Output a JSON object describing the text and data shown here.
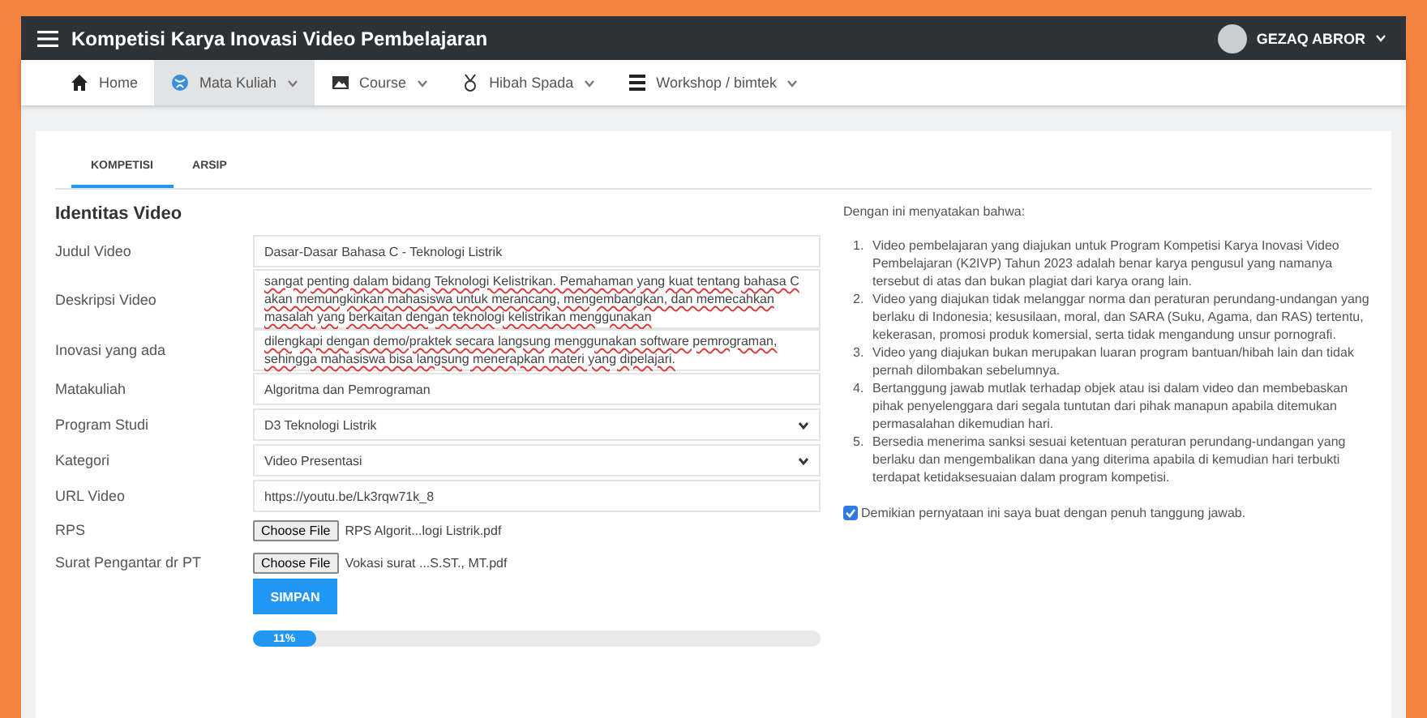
{
  "header": {
    "title": "Kompetisi Karya Inovasi Video Pembelajaran",
    "user": "GEZAQ ABROR"
  },
  "nav": [
    {
      "kind": "link",
      "label": "Home",
      "selected": false
    },
    {
      "kind": "menu",
      "label": "Mata Kuliah",
      "selected": true
    },
    {
      "kind": "menu",
      "label": "Course",
      "selected": false
    },
    {
      "kind": "menu",
      "label": "Hibah Spada",
      "selected": false
    },
    {
      "kind": "menu",
      "label": "Workshop / bimtek",
      "selected": false
    }
  ],
  "tabs": [
    {
      "label": "KOMPETISI",
      "selected": true
    },
    {
      "label": "ARSIP",
      "selected": false
    }
  ],
  "form": {
    "title": "Identitas Video",
    "fields": [
      {
        "kind": "text",
        "label": "Judul Video",
        "value": "Dasar-Dasar Bahasa C - Teknologi Listrik"
      },
      {
        "kind": "textarea",
        "label": "Deskripsi Video",
        "value": "sangat penting dalam bidang Teknologi Kelistrikan. Pemahaman yang kuat tentang bahasa C akan memungkinkan mahasiswa untuk merancang, mengembangkan, dan memecahkan masalah yang berkaitan dengan teknologi kelistrikan menggunakan"
      },
      {
        "kind": "textarea",
        "label": "Inovasi yang ada",
        "value": "dilengkapi dengan demo/praktek secara langsung menggunakan software pemrograman, sehingga mahasiswa bisa langsung menerapkan materi yang dipelajari."
      },
      {
        "kind": "text",
        "label": "Matakuliah",
        "value": "Algoritma dan Pemrograman"
      },
      {
        "kind": "select",
        "label": "Program Studi",
        "value": "D3 Teknologi Listrik"
      },
      {
        "kind": "select",
        "label": "Kategori",
        "value": "Video Presentasi"
      },
      {
        "kind": "text",
        "label": "URL Video",
        "value": "https://youtu.be/Lk3rqw71k_8"
      },
      {
        "kind": "file",
        "label": "RPS",
        "button": "Choose File",
        "value": "RPS Algorit...logi Listrik.pdf"
      },
      {
        "kind": "file",
        "label": "Surat Pengantar dr PT",
        "button": "Choose File",
        "value": "Vokasi surat ...S.ST., MT.pdf"
      }
    ],
    "submit": "SIMPAN",
    "progress": {
      "level": 0.11,
      "label": "11%"
    }
  },
  "statement": {
    "intro": "Dengan ini menyatakan bahwa:",
    "items": [
      {
        "number": "1.",
        "text": "Video pembelajaran yang diajukan untuk Program Kompetisi Karya Inovasi Video Pembelajaran (K2IVP) Tahun 2023 adalah benar karya pengusul yang namanya tersebut di atas dan bukan plagiat dari karya orang lain."
      },
      {
        "number": "2.",
        "text": "Video yang diajukan tidak melanggar norma dan peraturan perundang-undangan yang berlaku di Indonesia; kesusilaan, moral, dan SARA (Suku, Agama, dan RAS) tertentu, kekerasan, promosi produk komersial, serta tidak mengandung unsur pornografi."
      },
      {
        "number": "3.",
        "text": "Video yang diajukan bukan merupakan luaran program bantuan/hibah lain dan tidak pernah dilombakan sebelumnya."
      },
      {
        "number": "4.",
        "text": "Bertanggung jawab mutlak terhadap objek atau isi dalam video dan membebaskan pihak penyelenggara dari segala tuntutan dari pihak manapun apabila ditemukan permasalahan dikemudian hari."
      },
      {
        "number": "5.",
        "text": "Bersedia menerima sanksi sesuai ketentuan peraturan perundang-undangan yang berlaku dan mengembalikan dana yang diterima apabila di kemudian hari terbukti terdapat ketidaksesuaian dalam program kompetisi."
      }
    ],
    "agree": {
      "label": "Demikian pernyataan ini saya buat dengan penuh tanggung jawab.",
      "checked": true
    }
  }
}
